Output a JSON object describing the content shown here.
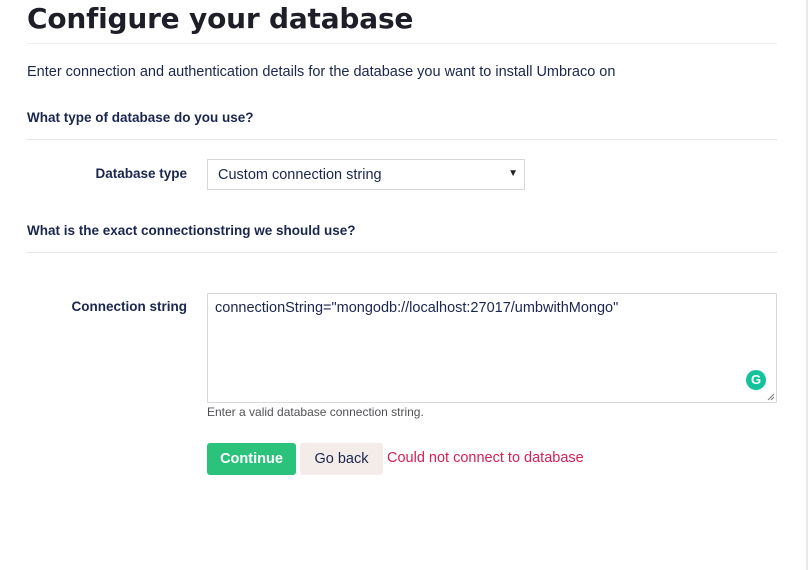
{
  "title": "Configure your database",
  "intro": "Enter connection and authentication details for the database you want to install Umbraco on",
  "section1": {
    "heading": "What type of database do you use?"
  },
  "db_type": {
    "label": "Database type",
    "value": "Custom connection string"
  },
  "section2": {
    "heading": "What is the exact connectionstring we should use?"
  },
  "connection": {
    "label": "Connection string",
    "value": "connectionString=\"mongodb://localhost:27017/umbwithMongo\"",
    "help": "Enter a valid database connection string.",
    "grammarly_glyph": "G"
  },
  "actions": {
    "continue_label": "Continue",
    "back_label": "Go back"
  },
  "error": "Could not connect to database",
  "colors": {
    "primary": "#2bc37c",
    "secondary": "#f3ece9",
    "error": "#d42054",
    "text": "#1b264f"
  }
}
